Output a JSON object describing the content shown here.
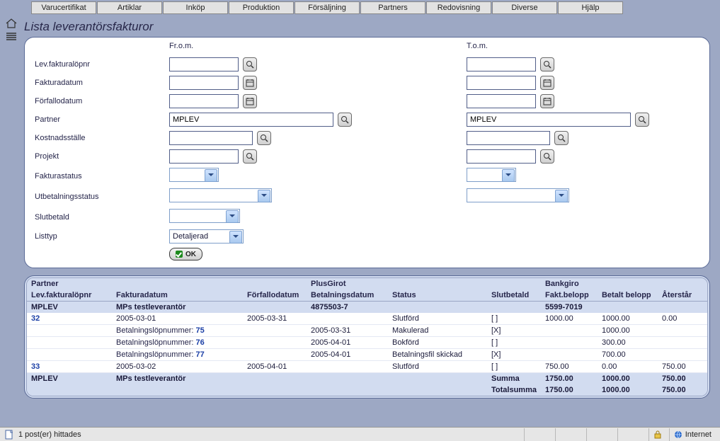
{
  "menu": [
    "Varucertifikat",
    "Artiklar",
    "Inköp",
    "Produktion",
    "Försäljning",
    "Partners",
    "Redovisning",
    "Diverse",
    "Hjälp"
  ],
  "title": "Lista leverantörsfakturor",
  "form": {
    "col_from": "Fr.o.m.",
    "col_to": "T.o.m.",
    "labels": {
      "lopnr": "Lev.fakturalöpnr",
      "fakturadatum": "Fakturadatum",
      "forfallodatum": "Förfallodatum",
      "partner": "Partner",
      "kostnad": "Kostnadsställe",
      "projekt": "Projekt",
      "fakturastatus": "Fakturastatus",
      "utbet": "Utbetalningsstatus",
      "slutbetald": "Slutbetald",
      "listtyp": "Listtyp"
    },
    "values": {
      "lopnr_from": "",
      "lopnr_to": "",
      "fakturadatum_from": "",
      "fakturadatum_to": "",
      "forfallodatum_from": "",
      "forfallodatum_to": "",
      "partner_from": "MPLEV",
      "partner_to": "MPLEV",
      "kostnad_from": "",
      "kostnad_to": "",
      "projekt_from": "",
      "projekt_to": "",
      "fakturastatus_from": "",
      "fakturastatus_to": "",
      "utbet_from": "",
      "utbet_to": "",
      "slutbetald": "",
      "listtyp": "Detaljerad"
    },
    "ok": "OK"
  },
  "grid": {
    "h1": {
      "partner": "Partner",
      "plusgirot": "PlusGirot",
      "bankgiro": "Bankgiro"
    },
    "h2": {
      "lopnr": "Lev.fakturalöpnr",
      "fakturadatum": "Fakturadatum",
      "forfallo": "Förfallodatum",
      "betdatum": "Betalningsdatum",
      "status": "Status",
      "slutbetald": "Slutbetald",
      "faktbelopp": "Fakt.belopp",
      "betaltbelopp": "Betalt belopp",
      "aterstar": "Återstår"
    },
    "group": {
      "partner": "MPLEV",
      "name": "MPs testleverantör",
      "plusgirot": "4875503-7",
      "bankgiro": "5599-7019"
    },
    "rows": [
      {
        "type": "data",
        "lopnr": "32",
        "fdat": "2005-03-01",
        "ffd": "2005-03-31",
        "bdat": "",
        "status": "Slutförd",
        "slut": "[  ]",
        "fb": "1000.00",
        "bb": "1000.00",
        "at": "0.00"
      },
      {
        "type": "bet",
        "label": "Betalningslöpnummer:",
        "nr": "75",
        "bdat": "2005-03-31",
        "status": "Makulerad",
        "slut": "[X]",
        "fb": "",
        "bb": "1000.00",
        "at": ""
      },
      {
        "type": "bet",
        "label": "Betalningslöpnummer:",
        "nr": "76",
        "bdat": "2005-04-01",
        "status": "Bokförd",
        "slut": "[  ]",
        "fb": "",
        "bb": "300.00",
        "at": ""
      },
      {
        "type": "bet",
        "label": "Betalningslöpnummer:",
        "nr": "77",
        "bdat": "2005-04-01",
        "status": "Betalningsfil skickad",
        "slut": "[X]",
        "fb": "",
        "bb": "700.00",
        "at": ""
      },
      {
        "type": "data",
        "lopnr": "33",
        "fdat": "2005-03-02",
        "ffd": "2005-04-01",
        "bdat": "",
        "status": "Slutförd",
        "slut": "[  ]",
        "fb": "750.00",
        "bb": "0.00",
        "at": "750.00"
      }
    ],
    "sum": {
      "partner": "MPLEV",
      "name": "MPs testleverantör",
      "label": "Summa",
      "fb": "1750.00",
      "bb": "1000.00",
      "at": "750.00"
    },
    "total": {
      "label": "Totalsumma",
      "fb": "1750.00",
      "bb": "1000.00",
      "at": "750.00"
    }
  },
  "status": {
    "left": "1 post(er) hittades",
    "zone": "Internet"
  }
}
